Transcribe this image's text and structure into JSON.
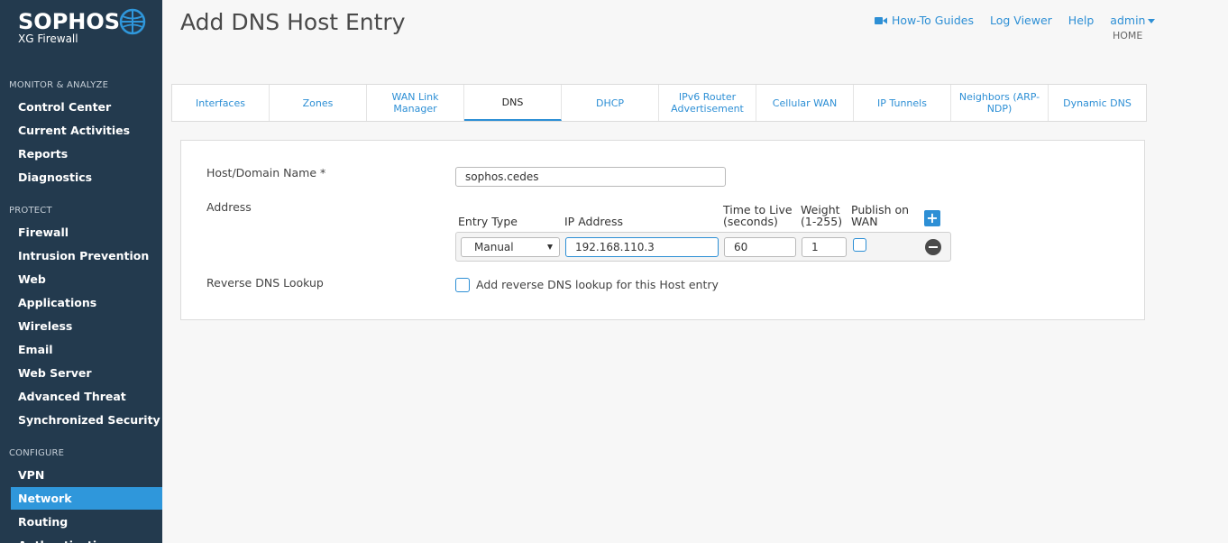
{
  "sidebar": {
    "brand": "SOPHOS",
    "product": "XG Firewall",
    "sections": [
      {
        "title": "MONITOR & ANALYZE",
        "items": [
          "Control Center",
          "Current Activities",
          "Reports",
          "Diagnostics"
        ]
      },
      {
        "title": "PROTECT",
        "items": [
          "Firewall",
          "Intrusion Prevention",
          "Web",
          "Applications",
          "Wireless",
          "Email",
          "Web Server",
          "Advanced Threat",
          "Synchronized Security"
        ]
      },
      {
        "title": "CONFIGURE",
        "items": [
          "VPN",
          "Network",
          "Routing",
          "Authentication"
        ]
      }
    ],
    "active_item": "Network"
  },
  "header": {
    "title": "Add DNS Host Entry",
    "links": {
      "howto": "How-To Guides",
      "log_viewer": "Log Viewer",
      "help": "Help",
      "admin": "admin"
    },
    "home": "HOME"
  },
  "tabs": [
    "Interfaces",
    "Zones",
    "WAN Link Manager",
    "DNS",
    "DHCP",
    "IPv6 Router Advertisement",
    "Cellular WAN",
    "IP Tunnels",
    "Neighbors (ARP-NDP)",
    "Dynamic DNS"
  ],
  "active_tab": "DNS",
  "form": {
    "host_label": "Host/Domain Name *",
    "host_value": "sophos.cedes",
    "address_label": "Address",
    "columns": {
      "entry_type": "Entry Type",
      "ip_address": "IP Address",
      "ttl_line1": "Time to Live",
      "ttl_line2": "(seconds)",
      "weight_line1": "Weight",
      "weight_line2": "(1-255)",
      "publish_line1": "Publish on",
      "publish_line2": "WAN"
    },
    "row": {
      "entry_type": "Manual",
      "ip_address": "192.168.110.3",
      "ttl": "60",
      "weight": "1",
      "publish_on_wan": false
    },
    "reverse_label": "Reverse DNS Lookup",
    "reverse_checkbox_label": "Add reverse DNS lookup for this Host entry",
    "reverse_checked": false
  },
  "colors": {
    "sidebar_bg": "#233a4e",
    "accent": "#2f97db",
    "link": "#2d8fd5"
  },
  "icons": {
    "brand_logo": "globe-icon",
    "howto": "video-camera-icon",
    "admin": "chevron-down-icon",
    "add_row": "plus-icon",
    "remove_row": "minus-circle-icon",
    "select": "caret-down-icon"
  }
}
